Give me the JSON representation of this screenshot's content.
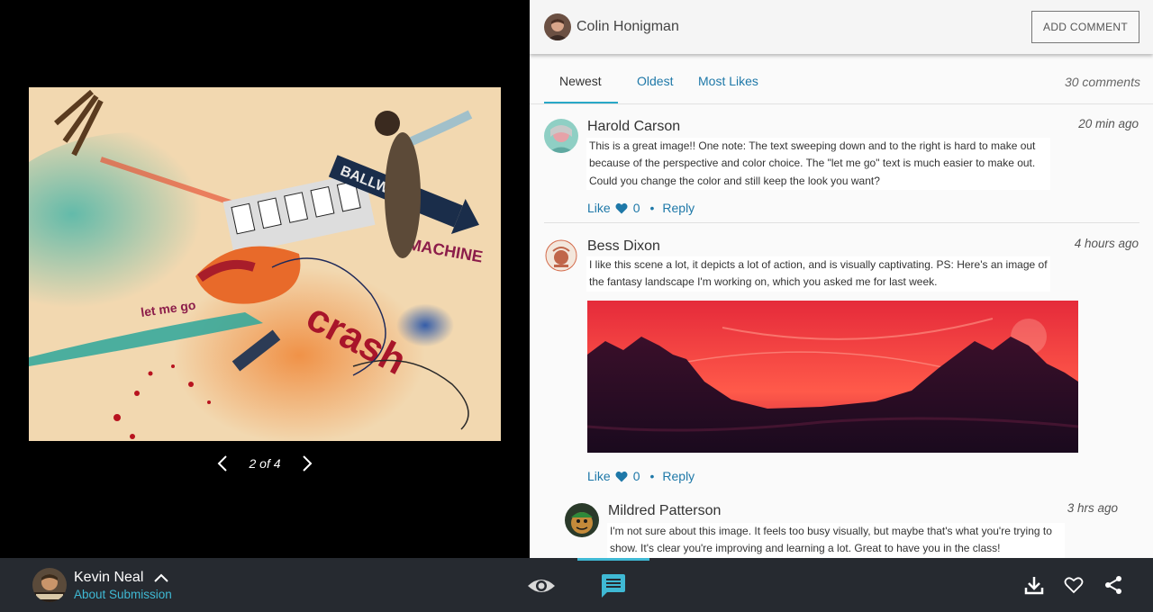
{
  "viewer": {
    "pager_text": "2 of 4",
    "artwork_texts": [
      "BALLWORK",
      "MACHINE",
      "let me go",
      "crash",
      "$",
      "$",
      "$",
      "$",
      "$"
    ]
  },
  "panel": {
    "owner_name": "Colin Honigman",
    "add_comment_label": "ADD COMMENT",
    "tabs": [
      "Newest",
      "Oldest",
      "Most Likes"
    ],
    "active_tab": "Newest",
    "comment_count": "30 comments"
  },
  "comments": [
    {
      "name": "Harold Carson",
      "time": "20 min ago",
      "text": "This is a great image!!  One note:  The text sweeping down and to the right is hard to make out because of the perspective and color choice.  The \"let me go\" text is much easier to make out.  Could you change the color and still keep the look you want?",
      "like_label": "Like",
      "likes": "0",
      "reply_label": "Reply"
    },
    {
      "name": "Bess Dixon",
      "time": "4 hours ago",
      "text": "I like this scene a lot, it depicts a lot of action, and is visually captivating.  PS: Here's an image of the fantasy landscape I'm working on, which you asked me for last week.",
      "like_label": "Like",
      "likes": "0",
      "reply_label": "Reply"
    },
    {
      "name": "Mildred Patterson",
      "time": "3 hrs ago",
      "text": "I'm not sure about this image.  It feels too busy visually, but maybe that's what you're trying to show.  It's clear you're improving and learning a lot.  Great to have you in the class!"
    }
  ],
  "bottombar": {
    "author_name": "Kevin Neal",
    "about_label": "About Submission",
    "icons": [
      "caret-up-icon",
      "eye-icon",
      "comment-icon",
      "download-icon",
      "heart-outline-icon",
      "share-icon"
    ]
  },
  "colors": {
    "accent": "#3fb9d4",
    "link": "#1e78a8",
    "bottombar_bg": "#262a30",
    "panel_bg": "#fafafa"
  }
}
